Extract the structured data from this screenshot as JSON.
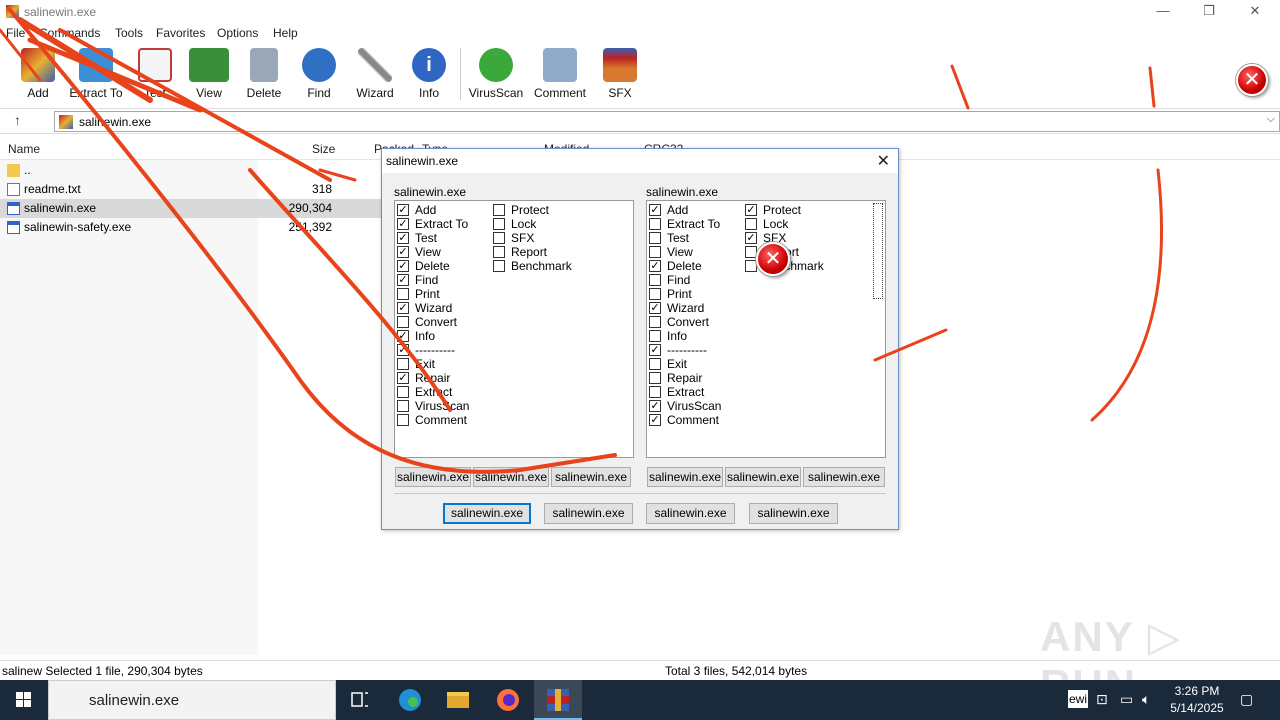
{
  "window": {
    "title": "salinewin.exe",
    "controls": [
      "—",
      "❐",
      "✕"
    ]
  },
  "menu": [
    "File",
    "Commands",
    "Tools",
    "Favorites",
    "Options",
    "Help"
  ],
  "toolbar": [
    {
      "label": "Add",
      "icon": "archive-add-icon",
      "color": "#c0392b"
    },
    {
      "label": "Extract To",
      "icon": "extract-folder-icon",
      "color": "#3b8fd6"
    },
    {
      "label": "Test",
      "icon": "checklist-icon",
      "color": "#c23b3b"
    },
    {
      "label": "View",
      "icon": "book-icon",
      "color": "#3a8f3a"
    },
    {
      "label": "Delete",
      "icon": "trash-icon",
      "color": "#7a8a9a"
    },
    {
      "label": "Find",
      "icon": "magnifier-icon",
      "color": "#2f6fc4"
    },
    {
      "label": "Wizard",
      "icon": "magic-wand-icon",
      "color": "#8a8a8a"
    },
    {
      "label": "Info",
      "icon": "info-icon",
      "color": "#2f66c4"
    },
    {
      "label": "VirusScan",
      "icon": "virus-icon",
      "color": "#3aa83a"
    },
    {
      "label": "Comment",
      "icon": "comment-icon",
      "color": "#8fa9c9"
    },
    {
      "label": "SFX",
      "icon": "sfx-box-icon",
      "color": "#d9782f"
    }
  ],
  "address": {
    "path": "salinewin.exe"
  },
  "columns": [
    "Name",
    "Size",
    "Packed",
    "Type",
    "Modified",
    "CRC32"
  ],
  "files": [
    {
      "name": "..",
      "size": "",
      "icon": "folder-icon"
    },
    {
      "name": "readme.txt",
      "size": "318",
      "icon": "text-file-icon"
    },
    {
      "name": "salinewin.exe",
      "size": "290,304",
      "icon": "exe-file-icon",
      "selected": true
    },
    {
      "name": "salinewin-safety.exe",
      "size": "251,392",
      "icon": "exe-file-icon"
    }
  ],
  "status": {
    "left": "salinew Selected 1 file, 290,304 bytes",
    "right": "Total 3 files, 542,014 bytes"
  },
  "dialog": {
    "title": "salinewin.exe",
    "left_group": {
      "label": "salinewin.exe",
      "col1": [
        {
          "label": "Add",
          "checked": true
        },
        {
          "label": "Extract To",
          "checked": true
        },
        {
          "label": "Test",
          "checked": true
        },
        {
          "label": "View",
          "checked": true
        },
        {
          "label": "Delete",
          "checked": true
        },
        {
          "label": "Find",
          "checked": true
        },
        {
          "label": "Print",
          "checked": false
        },
        {
          "label": "Wizard",
          "checked": true
        },
        {
          "label": "Convert",
          "checked": false
        },
        {
          "label": "Info",
          "checked": true
        },
        {
          "label": "----------",
          "checked": true
        },
        {
          "label": "Exit",
          "checked": false
        },
        {
          "label": "Repair",
          "checked": true
        },
        {
          "label": "Extract",
          "checked": false
        },
        {
          "label": "VirusScan",
          "checked": false
        },
        {
          "label": "Comment",
          "checked": false
        }
      ],
      "col2": [
        {
          "label": "Protect",
          "checked": false
        },
        {
          "label": "Lock",
          "checked": false
        },
        {
          "label": "SFX",
          "checked": false
        },
        {
          "label": "Report",
          "checked": false
        },
        {
          "label": "Benchmark",
          "checked": false
        }
      ],
      "buttons": [
        "salinewin.exe",
        "salinewin.exe",
        "salinewin.exe"
      ]
    },
    "right_group": {
      "label": "salinewin.exe",
      "col1": [
        {
          "label": "Add",
          "checked": true
        },
        {
          "label": "Extract To",
          "checked": false
        },
        {
          "label": "Test",
          "checked": false
        },
        {
          "label": "View",
          "checked": false
        },
        {
          "label": "Delete",
          "checked": true
        },
        {
          "label": "Find",
          "checked": false
        },
        {
          "label": "Print",
          "checked": false
        },
        {
          "label": "Wizard",
          "checked": true
        },
        {
          "label": "Convert",
          "checked": false
        },
        {
          "label": "Info",
          "checked": false
        },
        {
          "label": "----------",
          "checked": true
        },
        {
          "label": "Exit",
          "checked": false
        },
        {
          "label": "Repair",
          "checked": false
        },
        {
          "label": "Extract",
          "checked": false
        },
        {
          "label": "VirusScan",
          "checked": true
        },
        {
          "label": "Comment",
          "checked": true
        }
      ],
      "col2": [
        {
          "label": "Protect",
          "checked": true
        },
        {
          "label": "Lock",
          "checked": false
        },
        {
          "label": "SFX",
          "checked": true
        },
        {
          "label": "Report",
          "checked": false
        },
        {
          "label": "Benchmark",
          "checked": false
        }
      ],
      "buttons": [
        "salinewin.exe",
        "salinewin.exe",
        "salinewin.exe"
      ]
    },
    "bottom_buttons": [
      "salinewin.exe",
      "salinewin.exe",
      "salinewin.exe",
      "salinewin.exe"
    ]
  },
  "taskbar": {
    "search_text": "salinewin.exe",
    "time": "3:26 PM",
    "date": "5/14/2025",
    "tray_text": "ewi"
  },
  "watermark": "ANY RUN",
  "colors": {
    "accent": "#0078d7",
    "streak": "#e8431a",
    "taskbar": "#1b2a3a"
  }
}
